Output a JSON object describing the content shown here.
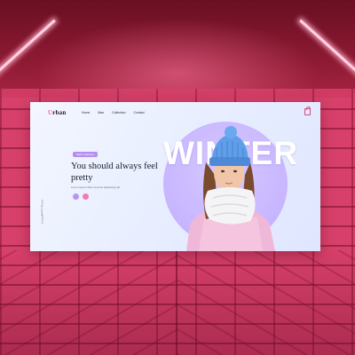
{
  "site": {
    "logo_first": "U",
    "logo_rest": "rban",
    "nav": [
      "Home",
      "Man",
      "Collection",
      "Contact"
    ],
    "badge": "NEW collection",
    "headline": "You should always feel pretty",
    "subtext": "Lorem ipsum dolor sit amet adipiscing elit",
    "big_word": "WINTER",
    "side_labels": [
      "Twitter",
      "Facebook",
      "Instagram"
    ]
  },
  "colors": {
    "accent": "#ff5fa0",
    "badge": "#b58ef0",
    "dot_a": "#b895f5",
    "dot_b": "#f07bb0",
    "tile": "#d7406a"
  },
  "icons": {
    "bag": "shopping-bag-icon"
  }
}
